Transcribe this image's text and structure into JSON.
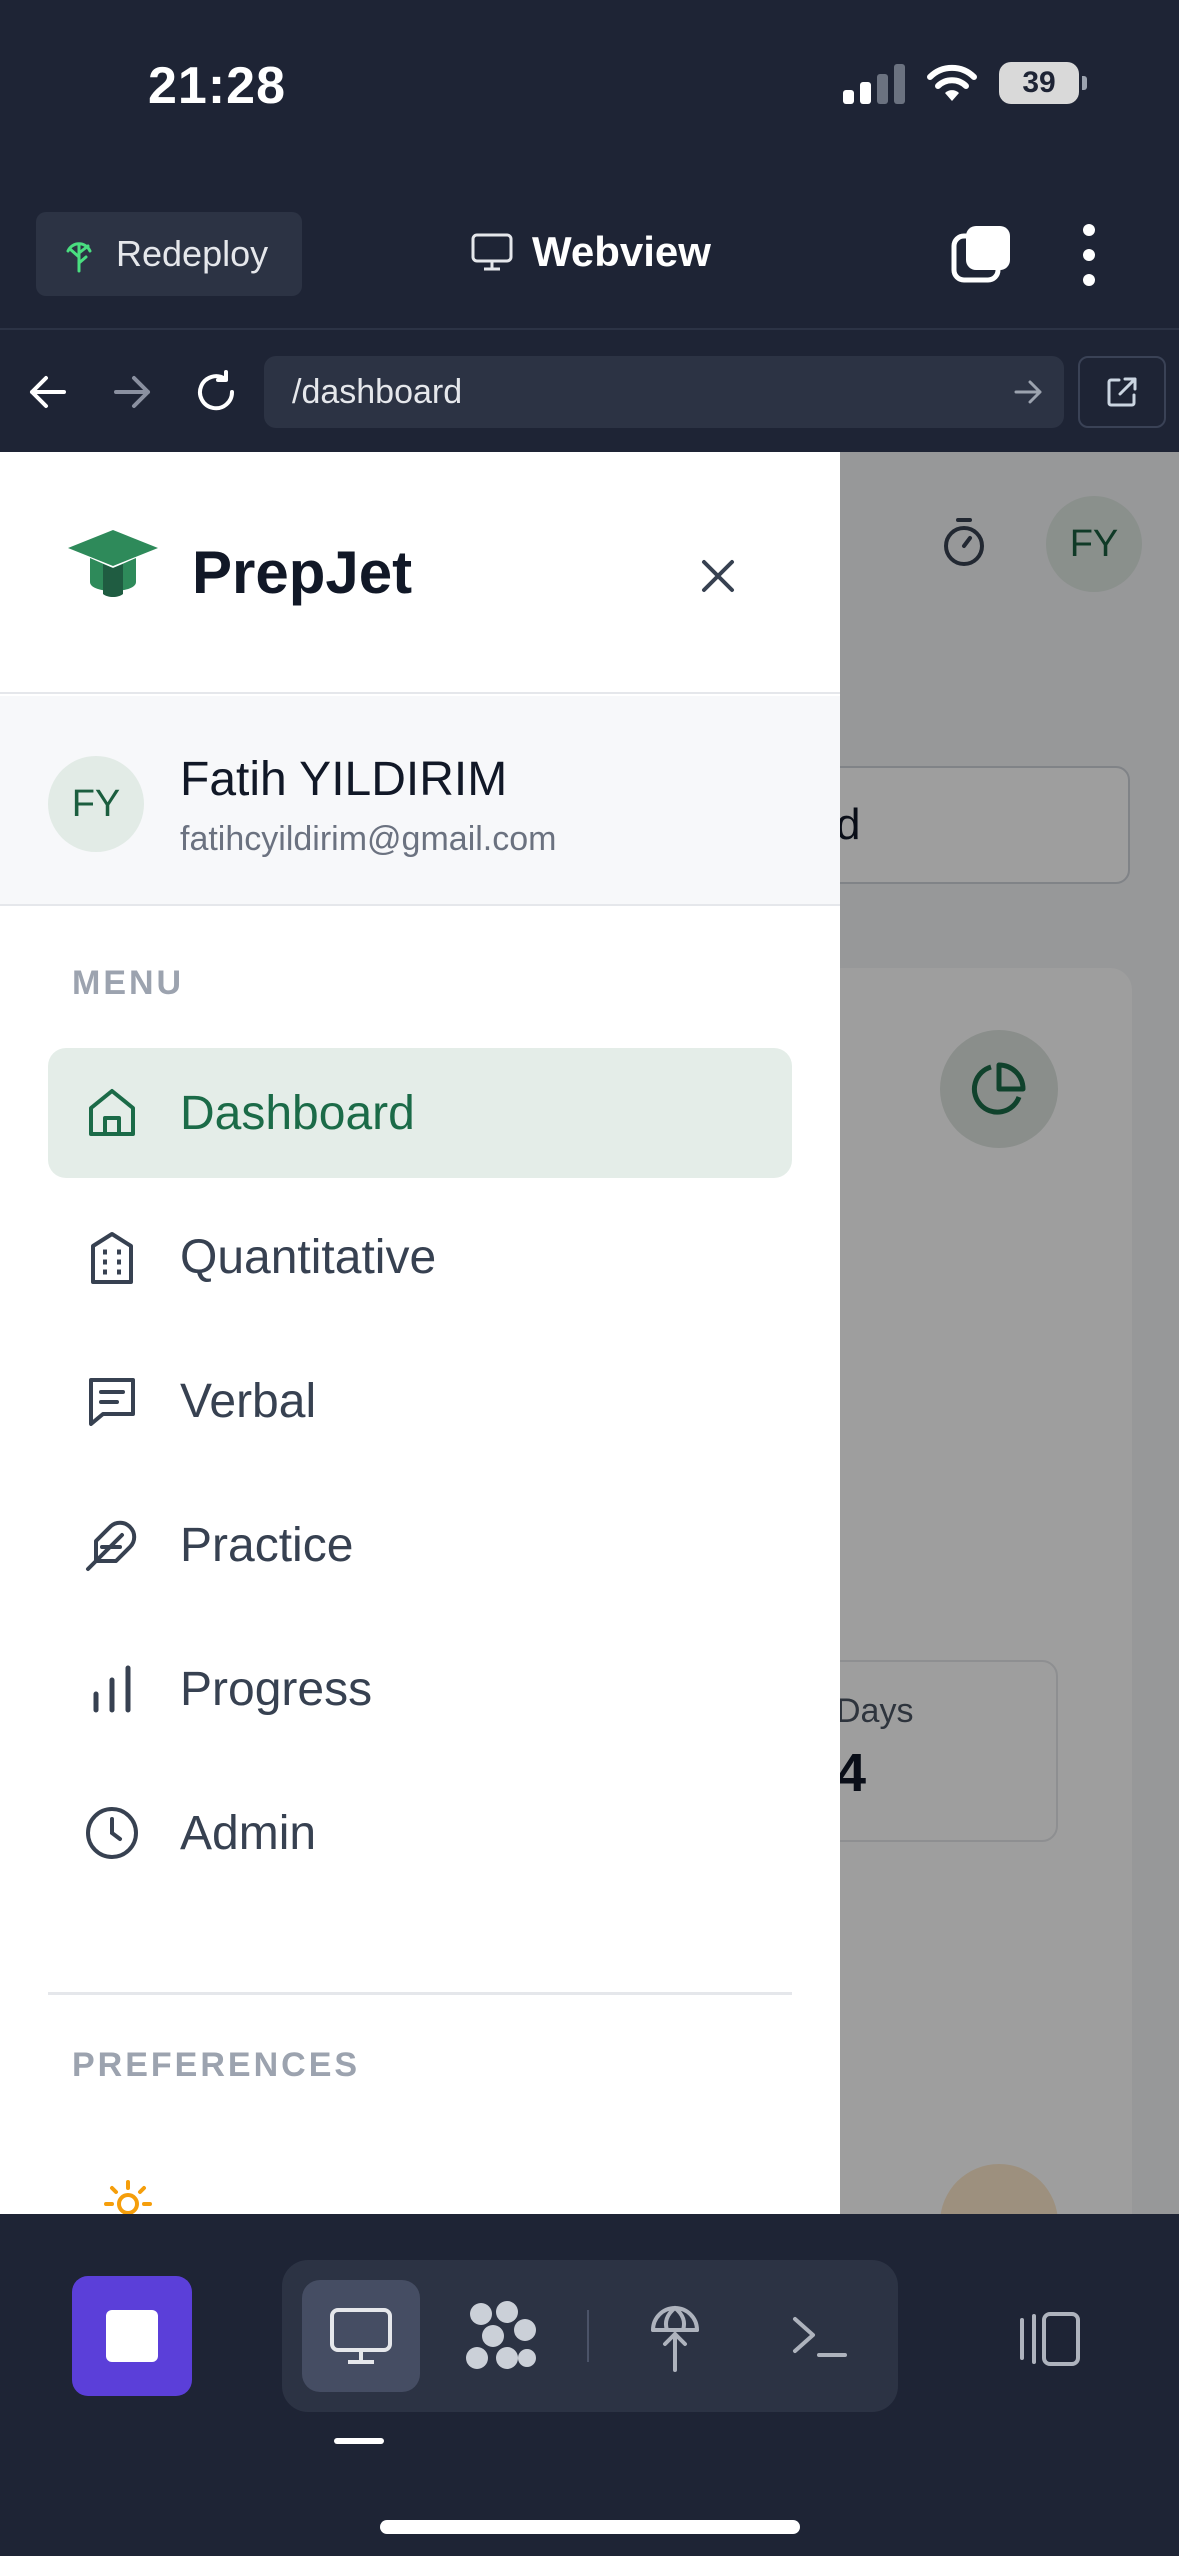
{
  "status_bar": {
    "time": "21:28",
    "battery": "39"
  },
  "top_bar": {
    "redeploy_label": "Redeploy",
    "webview_label": "Webview"
  },
  "nav_bar": {
    "url": "/dashboard"
  },
  "background_page": {
    "avatar_initials": "FY",
    "search_fragment": "d",
    "stat_label": "Days",
    "stat_value": "4"
  },
  "drawer": {
    "brand": "PrepJet",
    "user": {
      "initials": "FY",
      "name": "Fatih YILDIRIM",
      "email": "fatihcyildirim@gmail.com"
    },
    "menu_heading": "MENU",
    "menu_items": [
      {
        "label": "Dashboard",
        "icon": "home-icon",
        "active": true
      },
      {
        "label": "Quantitative",
        "icon": "building-icon",
        "active": false
      },
      {
        "label": "Verbal",
        "icon": "message-square-icon",
        "active": false
      },
      {
        "label": "Practice",
        "icon": "feather-icon",
        "active": false
      },
      {
        "label": "Progress",
        "icon": "bar-chart-icon",
        "active": false
      },
      {
        "label": "Admin",
        "icon": "clock-icon",
        "active": false
      }
    ],
    "preferences_heading": "PREFERENCES"
  },
  "colors": {
    "accent": "#1b6b48",
    "active_bg": "#e4ede8",
    "toolbar_bg": "#1e2435",
    "stop_button": "#5b3fd9"
  }
}
